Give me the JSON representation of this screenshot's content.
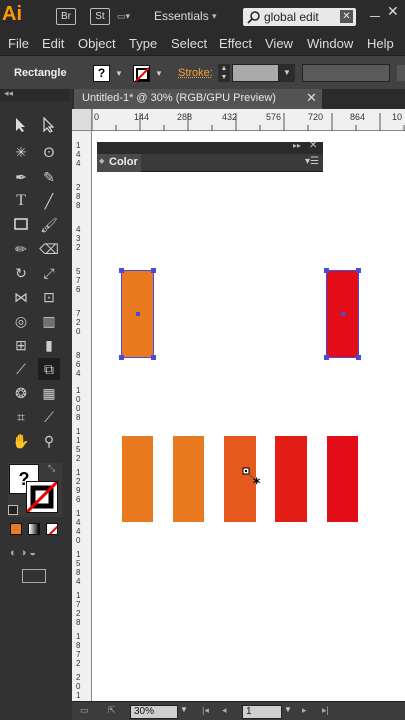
{
  "app": {
    "logo": "Ai",
    "bridge_label": "Br",
    "stock_label": "St",
    "workspace": "Essentials",
    "search": {
      "value": "global edit"
    },
    "close_glyph": "✕"
  },
  "menubar": {
    "items": [
      "File",
      "Edit",
      "Object",
      "Type",
      "Select",
      "Effect",
      "View",
      "Window",
      "Help"
    ]
  },
  "control_bar": {
    "tool_name": "Rectangle",
    "fill_glyph": "?",
    "stroke_label": "Stroke:"
  },
  "document": {
    "tab_title": "Untitled-1* @ 30% (RGB/GPU Preview)",
    "tab_close": "✕"
  },
  "ruler": {
    "h_ticks": [
      "0",
      "144",
      "288",
      "432",
      "576",
      "720",
      "864",
      "10"
    ],
    "v_labels": [
      "1\n4\n4",
      "2\n8\n8",
      "4\n3\n2",
      "5\n7\n6",
      "7\n2\n0",
      "8\n6\n4",
      "1\n0\n0\n8",
      "1\n1\n5\n2",
      "1\n2\n9\n6",
      "1\n4\n4\n0",
      "1\n5\n8\n4",
      "1\n7\n2\n8",
      "1\n8\n7\n2",
      "2\n0\n1\n6"
    ]
  },
  "color_panel": {
    "title": "Color"
  },
  "swatches": {
    "row1": [
      "#ea7a1f",
      "#e20d16"
    ],
    "row2": [
      "#ea7a1f",
      "#ea7a1f",
      "#e55a1c",
      "#e21d16",
      "#e20d16"
    ]
  },
  "status_bar": {
    "zoom": "30%",
    "page": "1"
  },
  "colors": {
    "selection": "#4b4bd8",
    "accent": "#ff9a00"
  }
}
